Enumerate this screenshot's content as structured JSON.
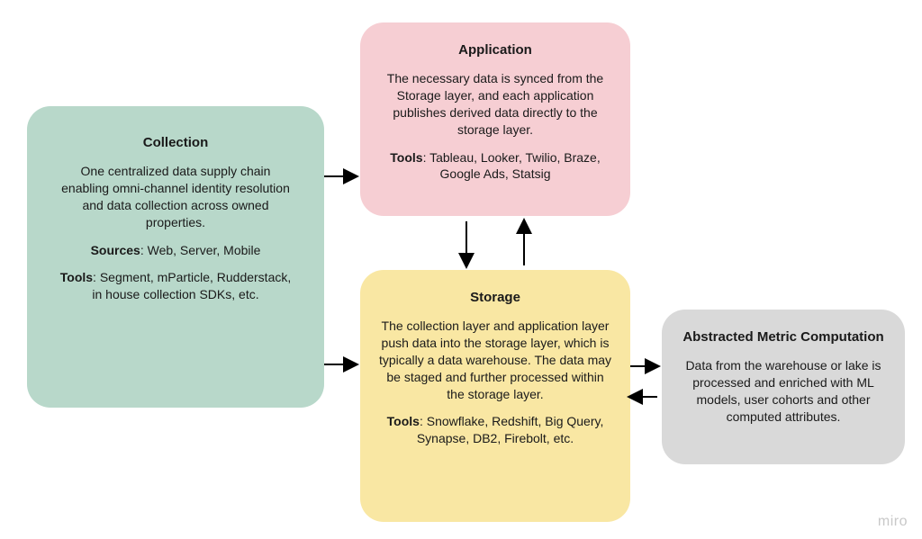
{
  "collection": {
    "title": "Collection",
    "desc": "One centralized data supply chain enabling omni-channel identity resolution and data collection across owned properties.",
    "sources_label": "Sources",
    "sources_text": ": Web, Server, Mobile",
    "tools_label": "Tools",
    "tools_text": ": Segment, mParticle, Rudderstack, in house collection SDKs, etc."
  },
  "application": {
    "title": "Application",
    "desc": "The necessary data is synced from the Storage layer, and each application publishes derived data directly to the storage layer.",
    "tools_label": "Tools",
    "tools_text": ": Tableau, Looker, Twilio, Braze, Google Ads, Statsig"
  },
  "storage": {
    "title": "Storage",
    "desc": "The collection layer and application layer push data into the storage layer, which is typically a data warehouse. The data may be staged and further processed within the storage layer.",
    "tools_label": "Tools",
    "tools_text": ": Snowflake, Redshift, Big Query, Synapse, DB2, Firebolt, etc."
  },
  "abstracted": {
    "title": "Abstracted Metric Computation",
    "desc": "Data from the warehouse or lake is processed and enriched with ML models, user cohorts and other computed attributes."
  },
  "brand": "miro"
}
